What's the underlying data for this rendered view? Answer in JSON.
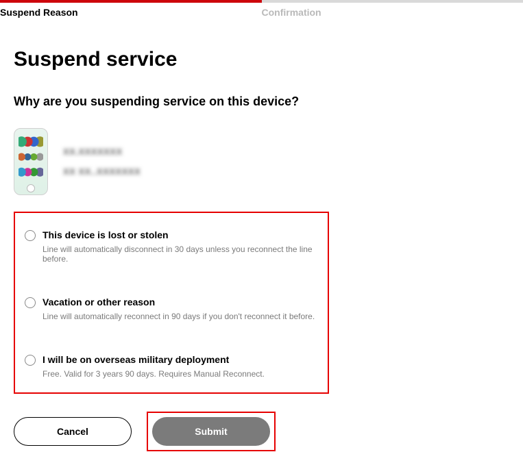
{
  "stepper": {
    "step1": "Suspend Reason",
    "step2": "Confirmation"
  },
  "page_title": "Suspend service",
  "question": "Why are you suspending service on this device?",
  "device": {
    "line1": "XX.XXXXXXX",
    "line2": "XX XX..XXXXXXX"
  },
  "options": [
    {
      "title": "This device is lost or stolen",
      "desc": "Line will automatically disconnect in 30 days unless you reconnect the line before."
    },
    {
      "title": "Vacation or other reason",
      "desc": "Line will automatically reconnect in 90 days if you don't reconnect it before."
    },
    {
      "title": "I will be on overseas military deployment",
      "desc": "Free. Valid for 3 years 90 days. Requires Manual Reconnect."
    }
  ],
  "buttons": {
    "cancel": "Cancel",
    "submit": "Submit"
  }
}
